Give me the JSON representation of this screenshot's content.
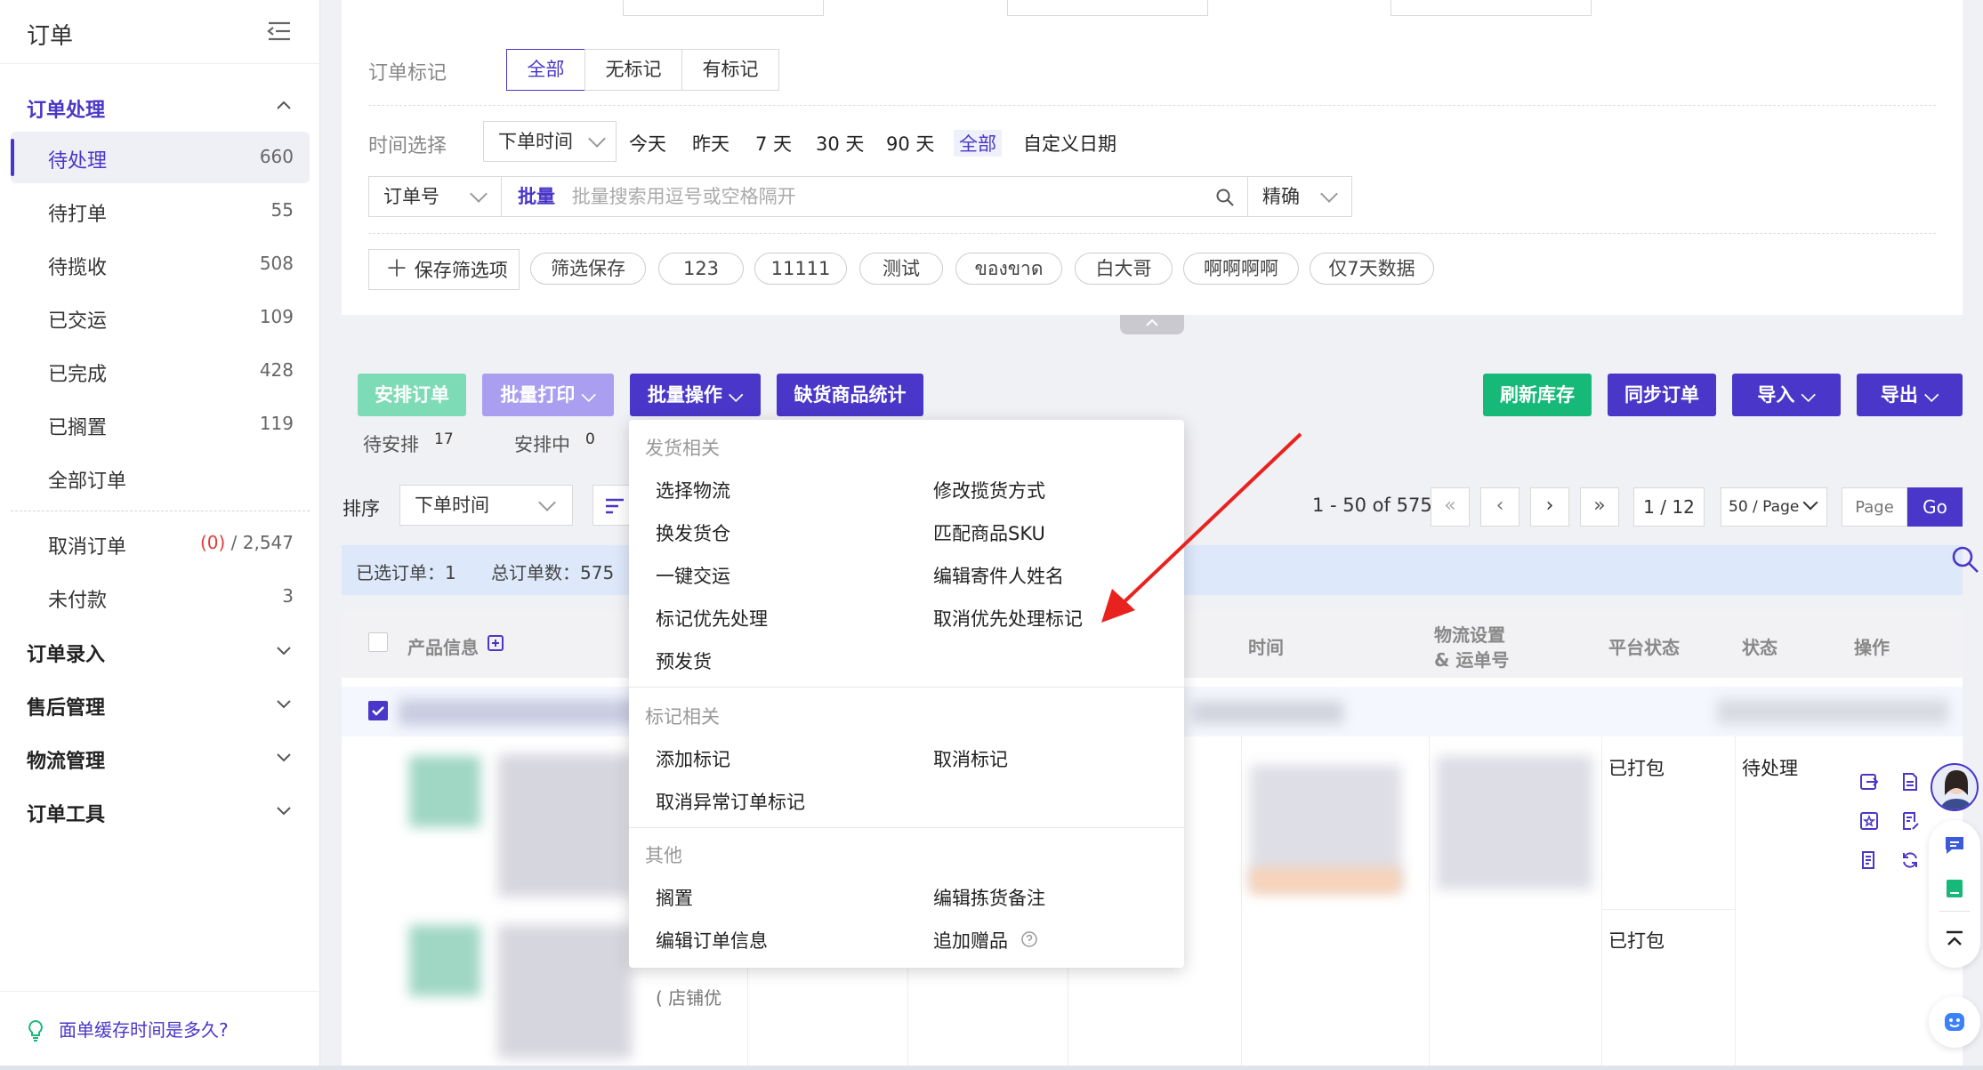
{
  "sidebar": {
    "title": "订单",
    "sections": {
      "order_processing": "订单处理",
      "order_entry": "订单录入",
      "after_sales": "售后管理",
      "logistics": "物流管理",
      "tools": "订单工具"
    },
    "items": [
      {
        "label": "待处理",
        "count": "660"
      },
      {
        "label": "待打单",
        "count": "55"
      },
      {
        "label": "待揽收",
        "count": "508"
      },
      {
        "label": "已交运",
        "count": "109"
      },
      {
        "label": "已完成",
        "count": "428"
      },
      {
        "label": "已搁置",
        "count": "119"
      },
      {
        "label": "全部订单",
        "count": ""
      }
    ],
    "cancel": {
      "label": "取消订单",
      "count_red": "(0)",
      "count_total": "/ 2,547"
    },
    "unpaid": {
      "label": "未付款",
      "count": "3"
    },
    "tip": "面单缓存时间是多久?"
  },
  "filter": {
    "mark_label": "订单标记",
    "mark_options": [
      "全部",
      "无标记",
      "有标记"
    ],
    "time_label": "时间选择",
    "time_type": "下单时间",
    "time_options": [
      "今天",
      "昨天",
      "7 天",
      "30 天",
      "90 天",
      "全部",
      "自定义日期"
    ],
    "search_field": "订单号",
    "batch_label": "批量",
    "search_placeholder": "批量搜索用逗号或空格隔开",
    "match_mode": "精确",
    "save_filter": "保存筛选项",
    "chips": [
      "筛选保存",
      "123",
      "11111",
      "测试",
      "ของขาด",
      "白大哥",
      "啊啊啊啊",
      "仅7天数据"
    ]
  },
  "toolbar": {
    "arrange": "安排订单",
    "batch_print": "批量打印",
    "batch_ops": "批量操作",
    "stockout_stats": "缺货商品统计",
    "refresh_stock": "刷新库存",
    "sync_orders": "同步订单",
    "import": "导入",
    "export": "导出",
    "pending_label": "待安排",
    "pending_count": "17",
    "arranging_label": "安排中",
    "arranging_count": "0"
  },
  "sort": {
    "label": "排序",
    "value": "下单时间"
  },
  "pagination": {
    "range": "1 - 50 of 575",
    "page": "1 / 12",
    "page_size": "50 / Page",
    "page_placeholder": "Page",
    "go": "Go"
  },
  "summary": {
    "selected": "已选订单：1",
    "total": "总订单数：575"
  },
  "table": {
    "headers": {
      "product": "产品信息",
      "time": "时间",
      "logistics_line1": "物流设置",
      "logistics_line2": "& 运单号",
      "platform_status": "平台状态",
      "status": "状态",
      "actions": "操作"
    },
    "rows": [
      {
        "platform_status": "已打包",
        "status": "待处理"
      },
      {
        "platform_status": "已打包",
        "status": ""
      }
    ],
    "partial_text": "( 店铺优"
  },
  "menu": {
    "groups": [
      {
        "title": "发货相关",
        "items": [
          "选择物流",
          "修改揽货方式",
          "换发货仓",
          "匹配商品SKU",
          "一键交运",
          "编辑寄件人姓名",
          "标记优先处理",
          "取消优先处理标记",
          "预发货"
        ]
      },
      {
        "title": "标记相关",
        "items": [
          "添加标记",
          "取消标记",
          "取消异常订单标记"
        ]
      },
      {
        "title": "其他",
        "items": [
          "搁置",
          "编辑拣货备注",
          "编辑订单信息",
          "追加赠品"
        ]
      }
    ]
  },
  "colors": {
    "primary": "#4a36c8",
    "green": "#17b978",
    "light_green": "#7ddbb5",
    "light_purple": "#a99ef0",
    "red_arrow": "#e8231f"
  }
}
